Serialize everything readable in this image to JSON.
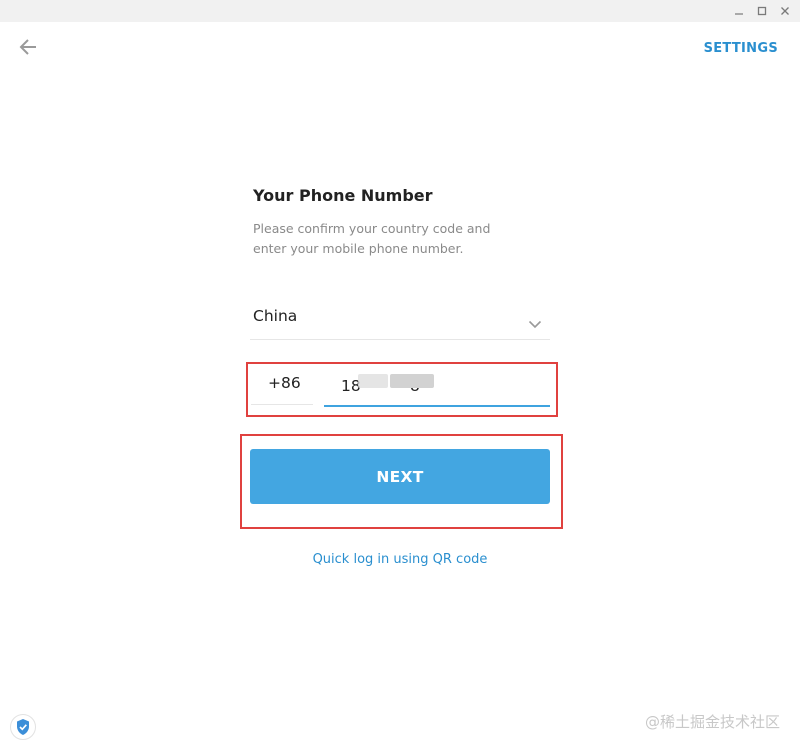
{
  "window": {
    "minimize_icon": "minimize-icon",
    "maximize_icon": "maximize-icon",
    "close_icon": "close-icon"
  },
  "header": {
    "back_icon": "arrow-left-icon",
    "settings_label": "SETTINGS"
  },
  "login": {
    "title": "Your Phone Number",
    "description": "Please confirm your country code and enter your mobile phone number.",
    "country": {
      "value": "China",
      "icon": "chevron-down-icon"
    },
    "country_code": "+86",
    "phone_number": "18          8",
    "next_label": "NEXT",
    "qr_link": "Quick log in using QR code"
  },
  "footer": {
    "shield_icon": "shield-check-icon",
    "watermark": "@稀土掘金技术社区"
  },
  "colors": {
    "accent": "#43a6e1",
    "link": "#2a8fcf",
    "highlight": "#e0413f",
    "titlebar": "#f1f1f1"
  }
}
